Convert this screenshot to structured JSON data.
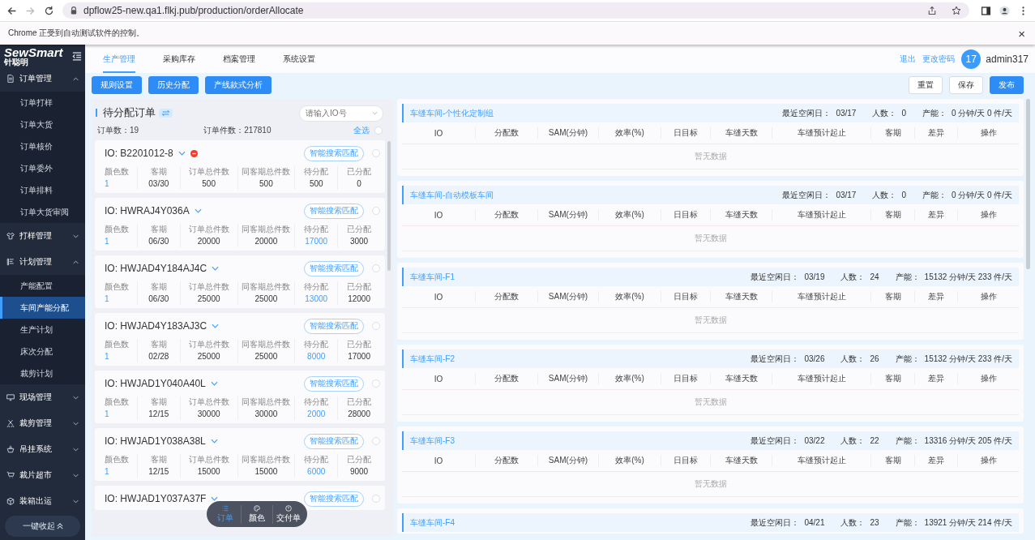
{
  "browser": {
    "url": "dpflow25-new.qa1.flkj.pub/production/orderAllocate",
    "infobar": "Chrome 正受到自动测试软件的控制。",
    "close": "×"
  },
  "sidebar": {
    "logo": "SewSmart",
    "logo_sub": "针聪明",
    "groups": [
      {
        "label": "订单管理",
        "expanded": true,
        "children": [
          {
            "label": "订单打样",
            "selected": false
          },
          {
            "label": "订单大货",
            "selected": false
          },
          {
            "label": "订单核价",
            "selected": false
          },
          {
            "label": "订单委外",
            "selected": false
          },
          {
            "label": "订单排料",
            "selected": false
          },
          {
            "label": "订单大货审阅",
            "selected": false
          }
        ]
      },
      {
        "label": "打样管理",
        "expanded": false
      },
      {
        "label": "计划管理",
        "expanded": true,
        "children": [
          {
            "label": "产能配置",
            "selected": false
          },
          {
            "label": "车间产能分配",
            "selected": true
          },
          {
            "label": "生产计划",
            "selected": false
          },
          {
            "label": "床次分配",
            "selected": false
          },
          {
            "label": "裁剪计划",
            "selected": false
          }
        ]
      },
      {
        "label": "现场管理",
        "expanded": false
      },
      {
        "label": "裁剪管理",
        "expanded": false
      },
      {
        "label": "吊挂系统",
        "expanded": false
      },
      {
        "label": "裁片超市",
        "expanded": false
      },
      {
        "label": "装箱出运",
        "expanded": false
      }
    ],
    "collapse_button": "一键收起"
  },
  "topnav": {
    "tabs": [
      {
        "label": "生产管理",
        "selected": true
      },
      {
        "label": "采购库存",
        "selected": false
      },
      {
        "label": "档案管理",
        "selected": false
      },
      {
        "label": "系统设置",
        "selected": false
      }
    ],
    "logout": "退出",
    "change_password": "更改密码",
    "avatar": "17",
    "user": "admin317"
  },
  "toolbar": {
    "left_buttons": [
      "规则设置",
      "历史分配",
      "产线款式分析"
    ],
    "right_buttons": [
      {
        "label": "重置",
        "kind": "default"
      },
      {
        "label": "保存",
        "kind": "default"
      },
      {
        "label": "发布",
        "kind": "primary"
      }
    ]
  },
  "orders": {
    "title": "待分配订单",
    "search_placeholder": "请输入IO号",
    "order_count_label": "订单数：",
    "order_count": "19",
    "piece_count_label": "订单件数：",
    "piece_count": "217810",
    "select_all": "全选",
    "select_all_checked": false,
    "cards": [
      {
        "io": "IO: B2201012-8",
        "alert": true,
        "match_button": "智能搜索匹配",
        "selected": false,
        "stats": [
          {
            "label": "颜色数",
            "value": "1",
            "highlight": true
          },
          {
            "label": "客期",
            "value": "03/30",
            "highlight": false
          },
          {
            "label": "订单总件数",
            "value": "500",
            "highlight": false
          },
          {
            "label": "同客期总件数",
            "value": "500",
            "highlight": false
          },
          {
            "label": "待分配",
            "value": "500",
            "highlight": false
          },
          {
            "label": "已分配",
            "value": "0",
            "highlight": false
          }
        ]
      },
      {
        "io": "IO: HWRAJ4Y036A",
        "alert": false,
        "match_button": "智能搜索匹配",
        "selected": false,
        "stats": [
          {
            "label": "颜色数",
            "value": "1",
            "highlight": true
          },
          {
            "label": "客期",
            "value": "06/30",
            "highlight": false
          },
          {
            "label": "订单总件数",
            "value": "20000",
            "highlight": false
          },
          {
            "label": "同客期总件数",
            "value": "20000",
            "highlight": false
          },
          {
            "label": "待分配",
            "value": "17000",
            "highlight": true
          },
          {
            "label": "已分配",
            "value": "3000",
            "highlight": false
          }
        ]
      },
      {
        "io": "IO: HWJAD4Y184AJ4C",
        "alert": false,
        "match_button": "智能搜索匹配",
        "selected": false,
        "stats": [
          {
            "label": "颜色数",
            "value": "1",
            "highlight": true
          },
          {
            "label": "客期",
            "value": "06/30",
            "highlight": false
          },
          {
            "label": "订单总件数",
            "value": "25000",
            "highlight": false
          },
          {
            "label": "同客期总件数",
            "value": "25000",
            "highlight": false
          },
          {
            "label": "待分配",
            "value": "13000",
            "highlight": true
          },
          {
            "label": "已分配",
            "value": "12000",
            "highlight": false
          }
        ]
      },
      {
        "io": "IO: HWJAD4Y183AJ3C",
        "alert": false,
        "match_button": "智能搜索匹配",
        "selected": false,
        "stats": [
          {
            "label": "颜色数",
            "value": "1",
            "highlight": true
          },
          {
            "label": "客期",
            "value": "02/28",
            "highlight": false
          },
          {
            "label": "订单总件数",
            "value": "25000",
            "highlight": false
          },
          {
            "label": "同客期总件数",
            "value": "25000",
            "highlight": false
          },
          {
            "label": "待分配",
            "value": "8000",
            "highlight": true
          },
          {
            "label": "已分配",
            "value": "17000",
            "highlight": false
          }
        ]
      },
      {
        "io": "IO: HWJAD1Y040A40L",
        "alert": false,
        "match_button": "智能搜索匹配",
        "selected": false,
        "stats": [
          {
            "label": "颜色数",
            "value": "1",
            "highlight": true
          },
          {
            "label": "客期",
            "value": "12/15",
            "highlight": false
          },
          {
            "label": "订单总件数",
            "value": "30000",
            "highlight": false
          },
          {
            "label": "同客期总件数",
            "value": "30000",
            "highlight": false
          },
          {
            "label": "待分配",
            "value": "2000",
            "highlight": true
          },
          {
            "label": "已分配",
            "value": "28000",
            "highlight": false
          }
        ]
      },
      {
        "io": "IO: HWJAD1Y038A38L",
        "alert": false,
        "match_button": "智能搜索匹配",
        "selected": false,
        "stats": [
          {
            "label": "颜色数",
            "value": "1",
            "highlight": true
          },
          {
            "label": "客期",
            "value": "12/15",
            "highlight": false
          },
          {
            "label": "订单总件数",
            "value": "15000",
            "highlight": false
          },
          {
            "label": "同客期总件数",
            "value": "15000",
            "highlight": false
          },
          {
            "label": "待分配",
            "value": "6000",
            "highlight": true
          },
          {
            "label": "已分配",
            "value": "9000",
            "highlight": false
          }
        ]
      },
      {
        "io": "IO: HWJAD1Y037A37F",
        "alert": false,
        "match_button": "智能搜索匹配",
        "selected": false
      }
    ]
  },
  "float_tabs": [
    {
      "label": "订单",
      "selected": true
    },
    {
      "label": "颜色",
      "selected": false
    },
    {
      "label": "交付单",
      "selected": false
    }
  ],
  "workshops": [
    {
      "name": "车缝车间-个性化定制组",
      "idle_label": "最近空闲日：",
      "idle": "03/17",
      "people_label": "人数：",
      "people": "0",
      "capacity_label": "产能：",
      "capacity": "0 分钟/天 0 件/天",
      "columns": [
        "IO",
        "分配数",
        "SAM(分钟)",
        "效率(%)",
        "日目标",
        "车缝天数",
        "车缝预计起止",
        "客期",
        "差异",
        "操作"
      ],
      "empty": "暂无数据"
    },
    {
      "name": "车缝车间-自动模板车间",
      "idle_label": "最近空闲日：",
      "idle": "03/17",
      "people_label": "人数：",
      "people": "0",
      "capacity_label": "产能：",
      "capacity": "0 分钟/天 0 件/天",
      "columns": [
        "IO",
        "分配数",
        "SAM(分钟)",
        "效率(%)",
        "日目标",
        "车缝天数",
        "车缝预计起止",
        "客期",
        "差异",
        "操作"
      ],
      "empty": "暂无数据"
    },
    {
      "name": "车缝车间-F1",
      "idle_label": "最近空闲日：",
      "idle": "03/19",
      "people_label": "人数：",
      "people": "24",
      "capacity_label": "产能：",
      "capacity": "15132 分钟/天 233 件/天",
      "columns": [
        "IO",
        "分配数",
        "SAM(分钟)",
        "效率(%)",
        "日目标",
        "车缝天数",
        "车缝预计起止",
        "客期",
        "差异",
        "操作"
      ],
      "empty": "暂无数据"
    },
    {
      "name": "车缝车间-F2",
      "idle_label": "最近空闲日：",
      "idle": "03/26",
      "people_label": "人数：",
      "people": "26",
      "capacity_label": "产能：",
      "capacity": "15132 分钟/天 233 件/天",
      "columns": [
        "IO",
        "分配数",
        "SAM(分钟)",
        "效率(%)",
        "日目标",
        "车缝天数",
        "车缝预计起止",
        "客期",
        "差异",
        "操作"
      ],
      "empty": "暂无数据"
    },
    {
      "name": "车缝车间-F3",
      "idle_label": "最近空闲日：",
      "idle": "03/22",
      "people_label": "人数：",
      "people": "22",
      "capacity_label": "产能：",
      "capacity": "13316 分钟/天 205 件/天",
      "columns": [
        "IO",
        "分配数",
        "SAM(分钟)",
        "效率(%)",
        "日目标",
        "车缝天数",
        "车缝预计起止",
        "客期",
        "差异",
        "操作"
      ],
      "empty": "暂无数据"
    },
    {
      "name": "车缝车间-F4",
      "idle_label": "最近空闲日：",
      "idle": "04/21",
      "people_label": "人数：",
      "people": "23",
      "capacity_label": "产能：",
      "capacity": "13921 分钟/天 214 件/天"
    }
  ]
}
